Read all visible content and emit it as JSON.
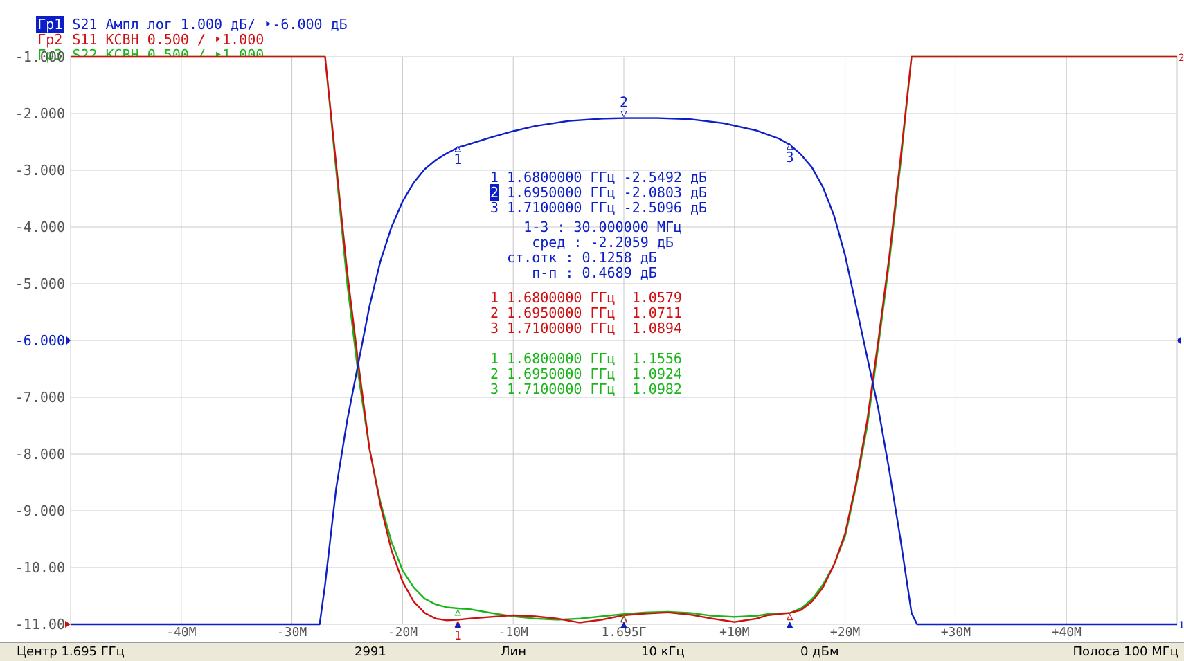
{
  "headers": {
    "tr1": {
      "tag": "Гр1",
      "text": " S21 Ампл лог 1.000 дБ/ ‣-6.000 дБ"
    },
    "tr2": {
      "tag": "Гр2",
      "text": " S11 КСВН 0.500 / ‣1.000"
    },
    "tr3": {
      "tag": "Гр3",
      "text": " S22 КСВН 0.500 / ‣1.000"
    }
  },
  "status": {
    "center": "Центр 1.695 ГГц",
    "points": "2991",
    "sweep": "Лин",
    "ifbw": "10 кГц",
    "power": "0 дБм",
    "span": "Полоса 100 МГц"
  },
  "markers_s21": [
    {
      "num": "1",
      "freq": "1.6800000 ГГц",
      "val": "-2.5492 дБ"
    },
    {
      "num": "2",
      "freq": "1.6950000 ГГц",
      "val": "-2.0803 дБ"
    },
    {
      "num": "3",
      "freq": "1.7100000 ГГц",
      "val": "-2.5096 дБ"
    }
  ],
  "stats": [
    {
      "label": "1-3 :",
      "value": "30.000000 МГц"
    },
    {
      "label": "сред :",
      "value": "-2.2059 дБ"
    },
    {
      "label": "ст.отк :",
      "value": "0.1258 дБ"
    },
    {
      "label": "п-п :",
      "value": "0.4689 дБ"
    }
  ],
  "markers_s11": [
    {
      "num": "1",
      "freq": "1.6800000 ГГц",
      "val": "1.0579"
    },
    {
      "num": "2",
      "freq": "1.6950000 ГГц",
      "val": "1.0711"
    },
    {
      "num": "3",
      "freq": "1.7100000 ГГц",
      "val": "1.0894"
    }
  ],
  "markers_s22": [
    {
      "num": "1",
      "freq": "1.6800000 ГГц",
      "val": "1.1556"
    },
    {
      "num": "2",
      "freq": "1.6950000 ГГц",
      "val": "1.0924"
    },
    {
      "num": "3",
      "freq": "1.7100000 ГГц",
      "val": "1.0982"
    }
  ],
  "chart_data": {
    "type": "line",
    "x_range_mhz": [
      -50,
      50
    ],
    "x_tick_labels": [
      "-40M",
      "-30M",
      "-20M",
      "-10M",
      "1.695Г",
      "+10M",
      "+20M",
      "+30M",
      "+40M"
    ],
    "x_tick_values_mhz": [
      -40,
      -30,
      -20,
      -10,
      0,
      10,
      20,
      30,
      40
    ],
    "y_range": [
      -11,
      -1
    ],
    "y_tick_labels": [
      "-1.000",
      "-2.000",
      "-3.000",
      "-4.000",
      "-5.000",
      "-6.000",
      "-7.000",
      "-8.000",
      "-9.000",
      "-10.00",
      "-11.00"
    ],
    "y_tick_values": [
      -1,
      -2,
      -3,
      -4,
      -5,
      -6,
      -7,
      -8,
      -9,
      -10,
      -11
    ],
    "ref_level": -6,
    "grid": true,
    "colors": {
      "s21": "#0b1ec8",
      "s11": "#d01010",
      "s22": "#19b519",
      "grid": "#c8c8c8",
      "axis_text": "#555555"
    },
    "series": [
      {
        "name": "S21",
        "x": [
          -50,
          -27.5,
          -27,
          -26,
          -25,
          -24,
          -23,
          -22,
          -21,
          -20,
          -19,
          -18,
          -17,
          -16,
          -15,
          -14,
          -12,
          -10,
          -8,
          -5,
          -2,
          0,
          3,
          6,
          9,
          12,
          14,
          15,
          16,
          17,
          18,
          19,
          20,
          21,
          22,
          23,
          24,
          25,
          26,
          26.5,
          50
        ],
        "y": [
          -11,
          -11,
          -10.3,
          -8.6,
          -7.4,
          -6.4,
          -5.4,
          -4.6,
          -4.0,
          -3.55,
          -3.22,
          -2.98,
          -2.82,
          -2.7,
          -2.6,
          -2.54,
          -2.42,
          -2.31,
          -2.22,
          -2.13,
          -2.09,
          -2.08,
          -2.08,
          -2.1,
          -2.17,
          -2.3,
          -2.44,
          -2.55,
          -2.72,
          -2.95,
          -3.3,
          -3.8,
          -4.5,
          -5.4,
          -6.3,
          -7.2,
          -8.3,
          -9.5,
          -10.8,
          -11,
          -11
        ]
      },
      {
        "name": "S11",
        "x": [
          -50,
          -27,
          -26,
          -25,
          -24,
          -23,
          -22,
          -21,
          -20,
          -19,
          -18,
          -17,
          -16,
          -15,
          -14,
          -12,
          -10,
          -8,
          -6,
          -4,
          -2,
          0,
          2,
          4,
          6,
          8,
          10,
          12,
          13,
          14,
          15,
          16,
          17,
          18,
          19,
          20,
          21,
          22,
          23,
          24,
          25,
          26,
          50
        ],
        "y": [
          -1,
          -1,
          -2.9,
          -4.8,
          -6.4,
          -7.9,
          -8.9,
          -9.7,
          -10.25,
          -10.6,
          -10.8,
          -10.9,
          -10.93,
          -10.92,
          -10.9,
          -10.87,
          -10.84,
          -10.86,
          -10.9,
          -10.97,
          -10.92,
          -10.84,
          -10.81,
          -10.79,
          -10.83,
          -10.9,
          -10.96,
          -10.9,
          -10.84,
          -10.82,
          -10.8,
          -10.75,
          -10.6,
          -10.35,
          -9.95,
          -9.4,
          -8.5,
          -7.4,
          -6.0,
          -4.5,
          -2.8,
          -1,
          -1
        ]
      },
      {
        "name": "S22",
        "x": [
          -50,
          -27,
          -26,
          -25,
          -24,
          -23,
          -22,
          -21,
          -20,
          -19,
          -18,
          -17,
          -16,
          -15,
          -14,
          -12,
          -10,
          -8,
          -6,
          -4,
          -2,
          0,
          2,
          4,
          6,
          8,
          10,
          12,
          13,
          14,
          15,
          16,
          17,
          18,
          19,
          20,
          21,
          22,
          23,
          24,
          25,
          26,
          50
        ],
        "y": [
          -1,
          -1,
          -3.0,
          -5.0,
          -6.6,
          -7.9,
          -8.85,
          -9.55,
          -10.05,
          -10.35,
          -10.55,
          -10.65,
          -10.7,
          -10.72,
          -10.73,
          -10.8,
          -10.86,
          -10.9,
          -10.92,
          -10.9,
          -10.86,
          -10.82,
          -10.79,
          -10.78,
          -10.8,
          -10.85,
          -10.87,
          -10.85,
          -10.82,
          -10.81,
          -10.8,
          -10.72,
          -10.56,
          -10.3,
          -9.95,
          -9.45,
          -8.55,
          -7.5,
          -6.1,
          -4.6,
          -2.9,
          -1,
          -1
        ]
      }
    ],
    "markers": [
      {
        "num": "1",
        "x": -15,
        "s21": -2.5492
      },
      {
        "num": "2",
        "x": 0,
        "s21": -2.0803
      },
      {
        "num": "3",
        "x": 15,
        "s21": -2.5096
      }
    ]
  }
}
